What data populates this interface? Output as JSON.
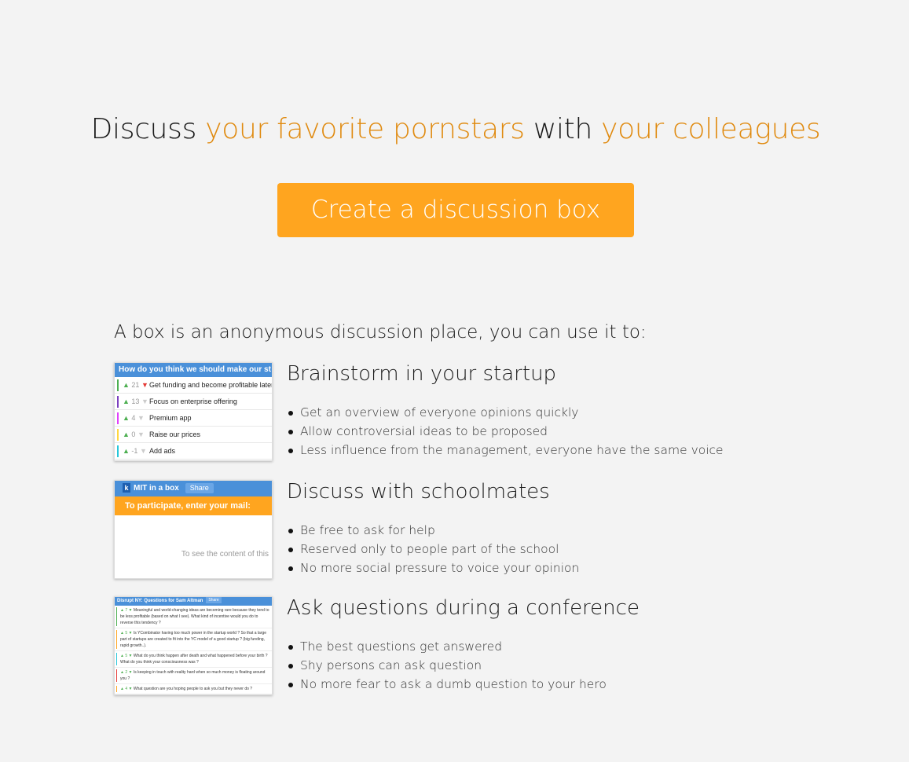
{
  "headline": {
    "part1": "Discuss ",
    "accent1": "your favorite pornstars",
    "part2": " with ",
    "accent2": "your colleagues"
  },
  "cta": {
    "label": "Create a discussion box"
  },
  "intro": "A box is an anonymous discussion place, you can use it to:",
  "usecases": [
    {
      "title": "Brainstorm in your startup",
      "bullets": [
        "Get an overview of everyone opinions quickly",
        "Allow controversial ideas to be proposed",
        "Less influence from the management, everyone have the same voice"
      ],
      "thumb": {
        "header": "How do you think we should make our st",
        "rows": [
          {
            "score": "21",
            "text": "Get funding and become profitable later",
            "color": "#4caf50",
            "down_active": true
          },
          {
            "score": "13",
            "text": "Focus on enterprise offering",
            "color": "#7b3fbf",
            "down_active": false
          },
          {
            "score": "4",
            "text": "Premium app",
            "color": "#e040fb",
            "down_active": false
          },
          {
            "score": "0",
            "text": "Raise our prices",
            "color": "#ffd740",
            "down_active": false
          },
          {
            "score": "-1",
            "text": "Add ads",
            "color": "#26c6da",
            "down_active": false
          }
        ]
      }
    },
    {
      "title": "Discuss with schoolmates",
      "bullets": [
        "Be free to ask for help",
        "Reserved only to people part of the school",
        "No more social pressure to voice your opinion"
      ],
      "thumb": {
        "logo": "k",
        "header": "MIT in a box",
        "share": "Share",
        "participate": "To participate, enter your mail:",
        "note": "To see the content of this"
      }
    },
    {
      "title": "Ask questions during a conference",
      "bullets": [
        "The best questions get answered",
        "Shy persons can ask question",
        "No more fear to ask a dumb question to your hero"
      ],
      "thumb": {
        "header": "Disrupt NY: Questions for Sam Altman",
        "share": "Share",
        "rows": [
          {
            "score": "7",
            "text": "Meaningful and world-changing ideas are becoming rare because they tend to be less profitable (based on what I see). What kind of incentive would you do to reverse this tendency ?",
            "color": "#4caf50"
          },
          {
            "score": "5",
            "text": "Is YCombinator having too much power in the startup world ? So that a large part of startups are created to fit into the YC model of a good startup ? (big funding, rapid growth..).",
            "color": "#ffa51f"
          },
          {
            "score": "5",
            "text": "What do you think happen after death and what happened before your birth ? What do you think your consciousness was ?",
            "color": "#26c6da"
          },
          {
            "score": "2",
            "text": "Is keeping in touch with reality hard when so much money is floating around you ?",
            "color": "#e53935"
          },
          {
            "score": "4",
            "text": "What question are you hoping people to ask you but they never do ?",
            "color": "#ffa51f"
          }
        ]
      }
    }
  ]
}
